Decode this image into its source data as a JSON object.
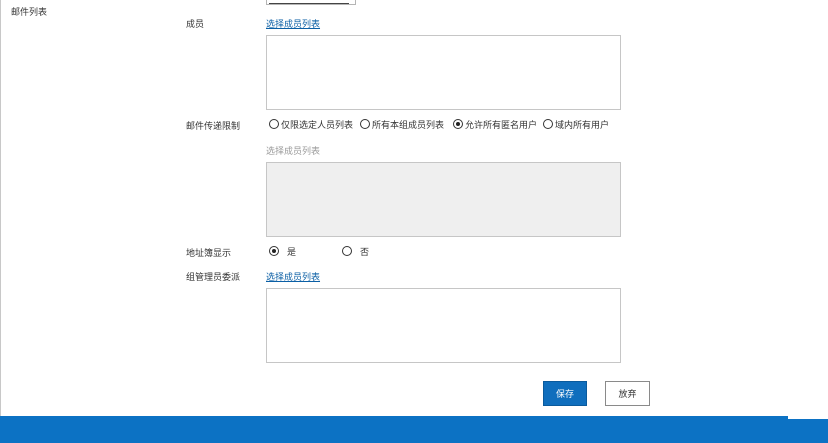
{
  "section": {
    "title": "邮件列表"
  },
  "members": {
    "label": "成员",
    "select_link": "选择成员列表"
  },
  "delivery_restriction": {
    "label": "邮件传递限制",
    "options": [
      {
        "label": "仅限选定人员列表",
        "checked": false
      },
      {
        "label": "所有本组成员列表",
        "checked": false
      },
      {
        "label": "允许所有匿名用户",
        "checked": true
      },
      {
        "label": "域内所有用户",
        "checked": false
      }
    ],
    "select_label_disabled": "选择成员列表"
  },
  "address_book": {
    "label": "地址簿显示",
    "options": [
      {
        "label": "是",
        "checked": true
      },
      {
        "label": "否",
        "checked": false
      }
    ]
  },
  "group_admin": {
    "label": "组管理员委派",
    "select_link": "选择成员列表"
  },
  "buttons": {
    "save": "保存",
    "discard": "放弃"
  },
  "colors": {
    "primary": "#0f6ebd",
    "bottom_bar": "#0c72c4",
    "link": "#0b5fa5"
  }
}
